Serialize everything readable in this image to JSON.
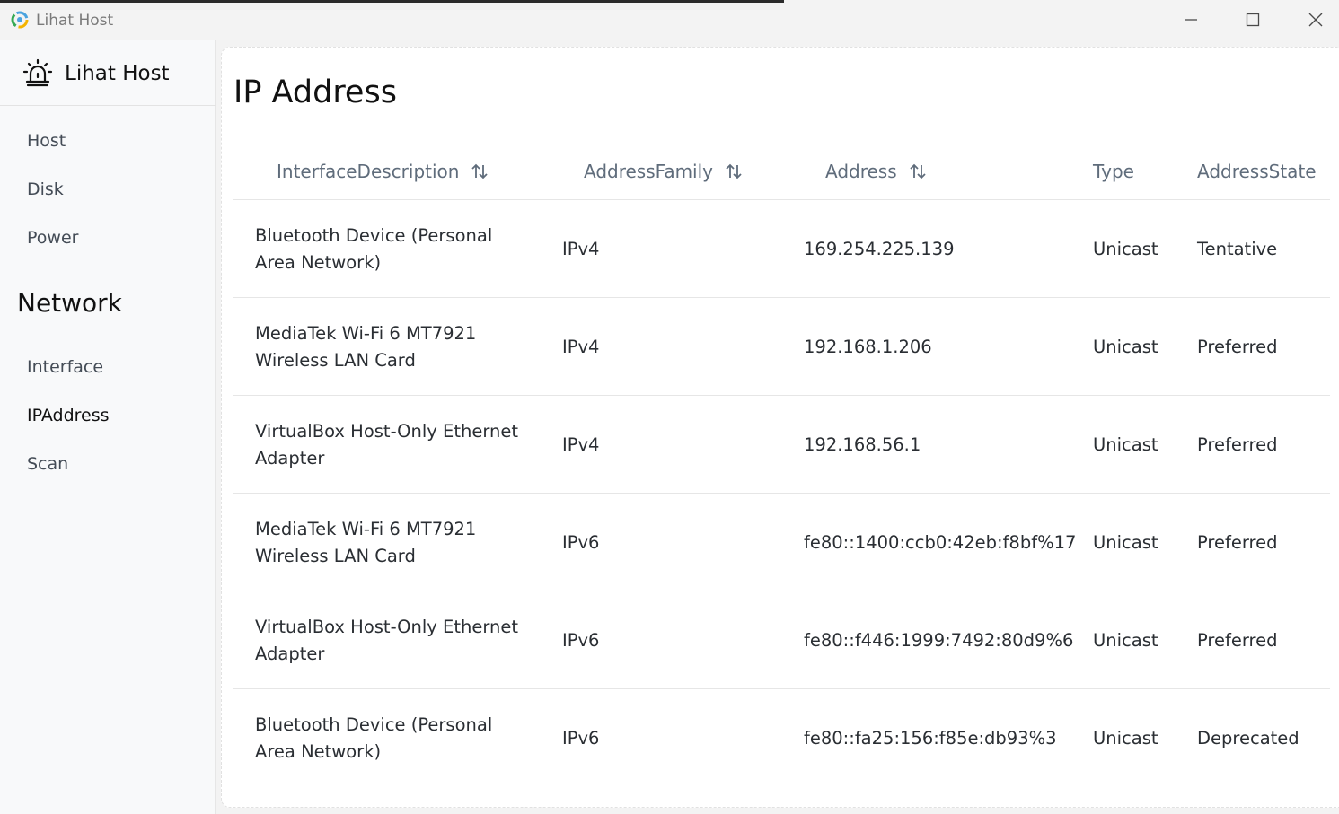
{
  "window": {
    "title": "Lihat Host"
  },
  "sidebar": {
    "brand": "Lihat Host",
    "items_top": [
      "Host",
      "Disk",
      "Power"
    ],
    "group_label": "Network",
    "items_network": [
      "Interface",
      "IPAddress",
      "Scan"
    ],
    "active_item": "IPAddress"
  },
  "main": {
    "title": "IP Address",
    "columns": [
      {
        "label": "InterfaceDescription",
        "sortable": true
      },
      {
        "label": "AddressFamily",
        "sortable": true
      },
      {
        "label": "Address",
        "sortable": true
      },
      {
        "label": "Type",
        "sortable": false
      },
      {
        "label": "AddressState",
        "sortable": false
      }
    ],
    "rows": [
      {
        "desc1": "Bluetooth Device (Personal",
        "desc2": "Area Network)",
        "family": "IPv4",
        "address": "169.254.225.139",
        "type": "Unicast",
        "state": "Tentative"
      },
      {
        "desc1": "MediaTek Wi-Fi 6 MT7921",
        "desc2": "Wireless LAN Card",
        "family": "IPv4",
        "address": "192.168.1.206",
        "type": "Unicast",
        "state": "Preferred"
      },
      {
        "desc1": "VirtualBox Host-Only Ethernet",
        "desc2": "Adapter",
        "family": "IPv4",
        "address": "192.168.56.1",
        "type": "Unicast",
        "state": "Preferred"
      },
      {
        "desc1": "MediaTek Wi-Fi 6 MT7921",
        "desc2": "Wireless LAN Card",
        "family": "IPv6",
        "address": "fe80::1400:ccb0:42eb:f8bf%17",
        "type": "Unicast",
        "state": "Preferred"
      },
      {
        "desc1": "VirtualBox Host-Only Ethernet",
        "desc2": "Adapter",
        "family": "IPv6",
        "address": "fe80::f446:1999:7492:80d9%6",
        "type": "Unicast",
        "state": "Preferred"
      },
      {
        "desc1": "Bluetooth Device (Personal",
        "desc2": "Area Network)",
        "family": "IPv6",
        "address": "fe80::fa25:156:f85e:db93%3",
        "type": "Unicast",
        "state": "Deprecated"
      }
    ]
  },
  "icons": {
    "app_logo": "lihat-logo-icon",
    "brand": "siren-alarm-icon",
    "sort": "sort-arrows-icon",
    "minimize": "minimize-icon",
    "maximize": "maximize-icon",
    "close": "close-icon"
  },
  "colors": {
    "sidebar_bg": "#f8f9fa",
    "content_bg": "#ffffff",
    "header_text": "#5f6c7b",
    "divider": "#e6e6e6"
  }
}
